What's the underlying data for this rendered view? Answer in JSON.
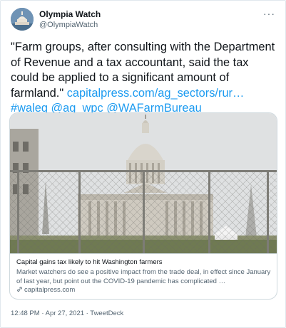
{
  "tweet": {
    "display_name": "Olympia Watch",
    "handle": "@OlympiaWatch",
    "more_glyph": "···",
    "text": {
      "quote": "\"Farm groups, after consulting with the Department of Revenue and a tax accountant, said the tax could be applied to a significant amount of farmland.\"",
      "link": "capitalpress.com/ag_sectors/rur…",
      "hashtag": "#waleg",
      "mention1": "@ag_wpc",
      "mention2": "@WAFarmBureau"
    },
    "card": {
      "title": "Capital gains tax likely to hit Washington farmers",
      "description": "Market watchers do see a positive impact from the trade deal, in effect since January of last year, but point out the COVID-19 pandemic has complicated …",
      "domain": "capitalpress.com"
    },
    "footer": {
      "time": "12:48 PM",
      "separator": "·",
      "date": "Apr 27, 2021",
      "source": "TweetDeck"
    }
  },
  "colors": {
    "link": "#1d9bf0",
    "secondary_text": "#536471",
    "border": "#cfd9de"
  }
}
